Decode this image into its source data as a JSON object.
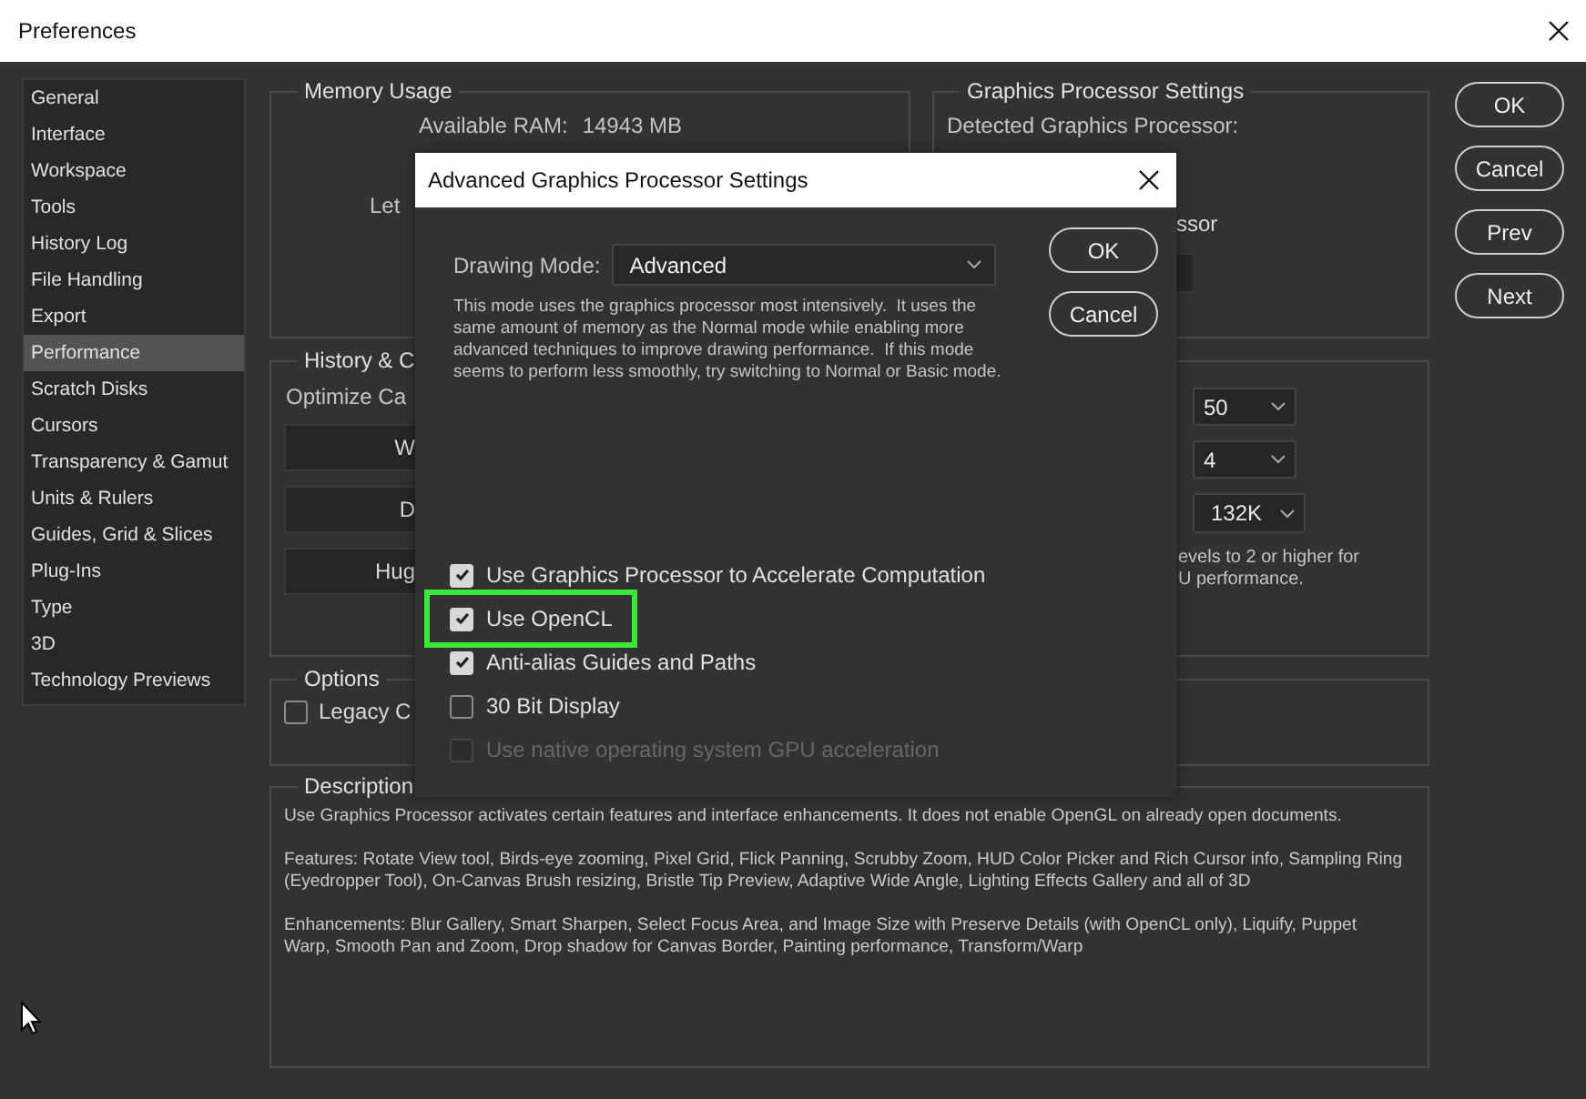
{
  "window": {
    "title": "Preferences"
  },
  "sidebar": {
    "items": [
      {
        "label": "General",
        "selected": false
      },
      {
        "label": "Interface",
        "selected": false
      },
      {
        "label": "Workspace",
        "selected": false
      },
      {
        "label": "Tools",
        "selected": false
      },
      {
        "label": "History Log",
        "selected": false
      },
      {
        "label": "File Handling",
        "selected": false
      },
      {
        "label": "Export",
        "selected": false
      },
      {
        "label": "Performance",
        "selected": true
      },
      {
        "label": "Scratch Disks",
        "selected": false
      },
      {
        "label": "Cursors",
        "selected": false
      },
      {
        "label": "Transparency & Gamut",
        "selected": false
      },
      {
        "label": "Units & Rulers",
        "selected": false
      },
      {
        "label": "Guides, Grid & Slices",
        "selected": false
      },
      {
        "label": "Plug-Ins",
        "selected": false
      },
      {
        "label": "Type",
        "selected": false
      },
      {
        "label": "3D",
        "selected": false
      },
      {
        "label": "Technology Previews",
        "selected": false
      }
    ]
  },
  "memory_usage": {
    "title": "Memory Usage",
    "available_ram_label": "Available RAM:",
    "available_ram": "14943 MB",
    "text_1": "Let"
  },
  "gpu_settings": {
    "title": "Graphics Processor Settings",
    "detected_label": "Detected Graphics Processor:",
    "text_1": "ssor"
  },
  "history_cache": {
    "title": "History & C",
    "optimize_label": "Optimize Ca",
    "buttons": [
      "W",
      "D",
      "Hug"
    ],
    "dropdowns": [
      "50",
      "4",
      "132K"
    ],
    "note_lines": [
      "evels to 2 or higher for",
      "U performance."
    ]
  },
  "options": {
    "title": "Options",
    "checkboxes": [
      {
        "label": "Legacy C",
        "checked": false
      }
    ]
  },
  "description": {
    "title": "Description",
    "paragraphs": [
      "Use Graphics Processor activates certain features and interface enhancements. It does not enable OpenGL on already open documents.",
      "Features: Rotate View tool, Birds-eye zooming, Pixel Grid, Flick Panning, Scrubby Zoom, HUD Color Picker and Rich Cursor info, Sampling Ring (Eyedropper Tool), On-Canvas Brush resizing, Bristle Tip Preview, Adaptive Wide Angle, Lighting Effects Gallery and all of 3D",
      "Enhancements: Blur Gallery, Smart Sharpen, Select Focus Area, and Image Size with Preserve Details (with OpenCL only), Liquify, Puppet Warp, Smooth Pan and Zoom, Drop shadow for Canvas Border, Painting performance, Transform/Warp"
    ]
  },
  "buttons": [
    "OK",
    "Cancel",
    "Prev",
    "Next"
  ],
  "dialog": {
    "title": "Advanced Graphics Processor Settings",
    "drawing_mode_label": "Drawing Mode:",
    "drawing_mode": "Advanced",
    "mode_description": "This mode uses the graphics processor most intensively.  It uses the same amount of memory as the Normal mode while enabling more advanced techniques to improve drawing performance.  If this mode seems to perform less smoothly, try switching to Normal or Basic mode.",
    "buttons": [
      "OK",
      "Cancel"
    ],
    "checkboxes": [
      {
        "label": "Use Graphics Processor to Accelerate Computation",
        "checked": true,
        "disabled": false,
        "highlighted": false
      },
      {
        "label": "Use OpenCL",
        "checked": true,
        "disabled": false,
        "highlighted": true
      },
      {
        "label": "Anti-alias Guides and Paths",
        "checked": true,
        "disabled": false,
        "highlighted": false
      },
      {
        "label": "30 Bit Display",
        "checked": false,
        "disabled": false,
        "highlighted": false
      },
      {
        "label": "Use native operating system GPU acceleration",
        "checked": false,
        "disabled": true,
        "highlighted": false
      }
    ]
  }
}
